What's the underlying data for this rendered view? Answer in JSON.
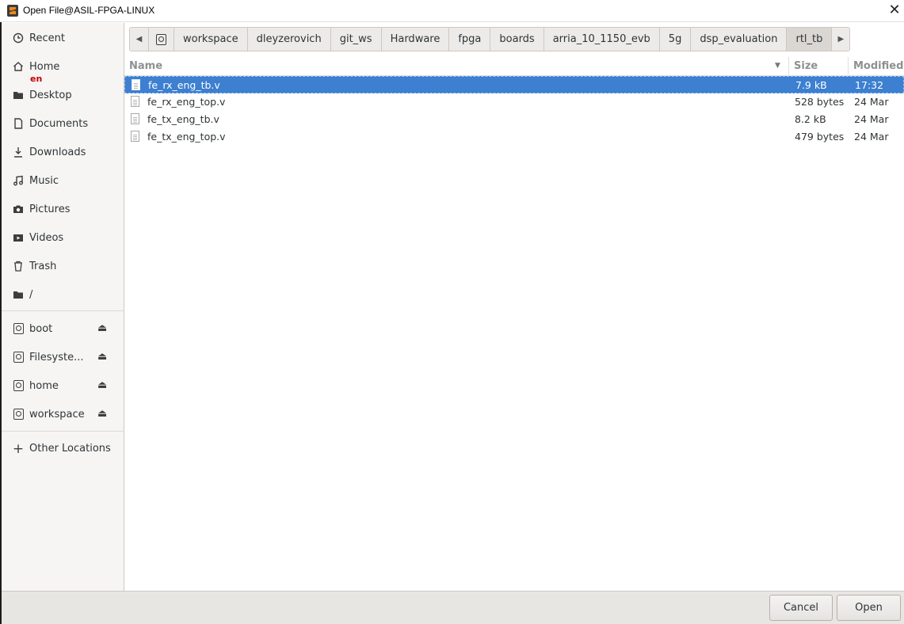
{
  "window": {
    "title": "Open File@ASIL-FPGA-LINUX",
    "close_glyph": "✕"
  },
  "sidebar": {
    "places": [
      {
        "label": "Recent",
        "icon": "clock-icon"
      },
      {
        "label": "Home",
        "icon": "home-icon"
      },
      {
        "label": "Desktop",
        "icon": "folder-icon"
      },
      {
        "label": "Documents",
        "icon": "document-icon"
      },
      {
        "label": "Downloads",
        "icon": "download-icon"
      },
      {
        "label": "Music",
        "icon": "music-icon"
      },
      {
        "label": "Pictures",
        "icon": "camera-icon"
      },
      {
        "label": "Videos",
        "icon": "video-icon"
      },
      {
        "label": "Trash",
        "icon": "trash-icon"
      },
      {
        "label": "/",
        "icon": "folder-icon"
      }
    ],
    "input_indicator": "en",
    "devices": [
      {
        "label": "boot",
        "icon": "drive-icon"
      },
      {
        "label": "Filesyste...",
        "icon": "drive-icon"
      },
      {
        "label": "home",
        "icon": "drive-icon"
      },
      {
        "label": "workspace",
        "icon": "drive-icon"
      }
    ],
    "other_locations": "Other Locations"
  },
  "pathbar": {
    "segments": [
      "workspace",
      "dleyzerovich",
      "git_ws",
      "Hardware",
      "fpga",
      "boards",
      "arria_10_1150_evb",
      "5g",
      "dsp_evaluation",
      "rtl_tb"
    ],
    "active": "rtl_tb"
  },
  "file_list": {
    "columns": {
      "name": "Name",
      "size": "Size",
      "modified": "Modified"
    },
    "rows": [
      {
        "name": "fe_rx_eng_tb.v",
        "size": "7.9 kB",
        "modified": "17:32",
        "selected": true
      },
      {
        "name": "fe_rx_eng_top.v",
        "size": "528 bytes",
        "modified": "24 Mar",
        "selected": false
      },
      {
        "name": "fe_tx_eng_tb.v",
        "size": "8.2 kB",
        "modified": "24 Mar",
        "selected": false
      },
      {
        "name": "fe_tx_eng_top.v",
        "size": "479 bytes",
        "modified": "24 Mar",
        "selected": false
      }
    ]
  },
  "buttons": {
    "cancel": "Cancel",
    "open": "Open"
  },
  "colors": {
    "selection": "#3d7fd0",
    "badge": "#c00000"
  }
}
